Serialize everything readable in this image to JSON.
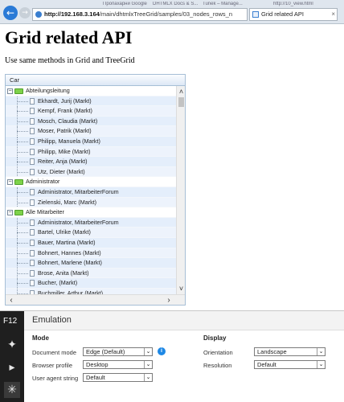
{
  "browser": {
    "url_host": "http://192.168.3.164",
    "url_path": "/main/dhtmlxTreeGrid/samples/03_nodes_rows_n",
    "faded_tabs": [
      "Пропахарни Google",
      "DHTMLX Docs & S...",
      "Tunek – Manage...",
      "http://10_view.html"
    ],
    "active_tab": "Grid related API",
    "close_glyph": "×"
  },
  "page": {
    "title": "Grid related API",
    "subtitle": "Use same methods in Grid and TreeGrid"
  },
  "grid": {
    "column_header": "Car",
    "rows": [
      {
        "type": "group",
        "label": "Abteilungsleitung",
        "toggle": "−"
      },
      {
        "type": "child",
        "label": "Ekhardt, Jurij (Markt)"
      },
      {
        "type": "child",
        "label": "Kempf, Frank (Markt)"
      },
      {
        "type": "child",
        "label": "Mosch, Claudia (Markt)"
      },
      {
        "type": "child",
        "label": "Moser, Patrik (Markt)"
      },
      {
        "type": "child",
        "label": "Philipp, Manuela (Markt)"
      },
      {
        "type": "child",
        "label": "Philipp, Mike (Markt)"
      },
      {
        "type": "child",
        "label": "Reiter, Anja (Markt)"
      },
      {
        "type": "child",
        "label": "Utz, Dieter (Markt)"
      },
      {
        "type": "group",
        "label": "Administrator",
        "toggle": "−"
      },
      {
        "type": "child",
        "label": "Administrator, MitarbeiterForum"
      },
      {
        "type": "child",
        "label": "Zielenski, Marc (Markt)"
      },
      {
        "type": "group",
        "label": "Alle Mitarbeiter",
        "toggle": "−"
      },
      {
        "type": "child",
        "label": "Administrator, MitarbeiterForum"
      },
      {
        "type": "child",
        "label": "Bartel, Ulrike (Markt)"
      },
      {
        "type": "child",
        "label": "Bauer, Martina (Markt)"
      },
      {
        "type": "child",
        "label": "Bohnert, Hannes (Markt)"
      },
      {
        "type": "child",
        "label": "Bohnert, Marlene (Markt)"
      },
      {
        "type": "child",
        "label": "Brose, Anita (Markt)"
      },
      {
        "type": "child",
        "label": "Bucher, (Markt)"
      },
      {
        "type": "child",
        "label": "Buchmiller, Arthur (Markt)"
      }
    ],
    "scroll_up": "˄",
    "scroll_down": "˅",
    "scroll_left": "‹",
    "scroll_right": "›"
  },
  "devtools": {
    "f12_label": "F12",
    "panel_title": "Emulation",
    "mode": {
      "heading": "Mode",
      "document_mode_label": "Document mode",
      "document_mode_value": "Edge (Default)",
      "browser_profile_label": "Browser profile",
      "browser_profile_value": "Desktop",
      "user_agent_label": "User agent string",
      "user_agent_value": "Default",
      "info_glyph": "i"
    },
    "display": {
      "heading": "Display",
      "orientation_label": "Orientation",
      "orientation_value": "Landscape",
      "resolution_label": "Resolution",
      "resolution_value": "Default"
    },
    "chevron": "⌄",
    "icons": [
      "dom-explorer-icon",
      "console-icon",
      "emulation-icon"
    ]
  },
  "colors": {
    "accent": "#2a7ad6",
    "grid_bg": "#eaf2fc",
    "folder": "#7ed24a"
  }
}
